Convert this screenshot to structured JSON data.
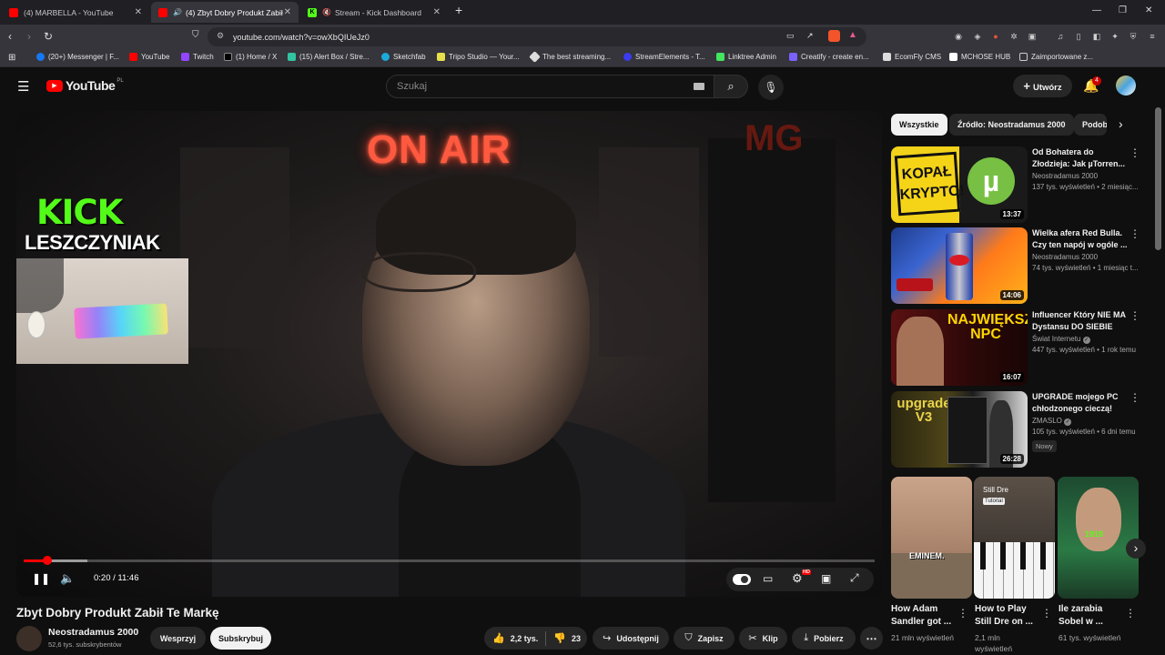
{
  "browser": {
    "tabs": [
      {
        "title": "(4) MARBELLA - YouTube"
      },
      {
        "title": "(4) Zbyt Dobry Produkt Zabił",
        "active": true
      },
      {
        "title": "Stream - Kick Dashboard"
      }
    ],
    "url": "youtube.com/watch?v=owXbQIUeJz0",
    "bookmarks": [
      "(20+) Messenger | F...",
      "YouTube",
      "Twitch",
      "(1) Home / X",
      "(15) Alert Box / Stre...",
      "Sketchfab",
      "Tripo Studio — Your...",
      "The best streaming...",
      "StreamElements - T...",
      "Linktree Admin",
      "Creatify - create en...",
      "EcomFly CMS",
      "MCHOSE HUB",
      "Zaimportowane z..."
    ]
  },
  "youtube": {
    "logo": "YouTube",
    "region": "PL",
    "search_placeholder": "Szukaj",
    "create_label": "Utwórz",
    "notifications": "4"
  },
  "video": {
    "title": "Zbyt Dobry Produkt Zabił Te Markę",
    "time": "0:20 / 11:46",
    "progress_fraction": 0.028,
    "buffered_fraction": 0.075,
    "overlay_sign": "ON AIR",
    "kick_logo": "KICK",
    "kick_name": "LESZCZYNIAK",
    "hd_badge": "HD"
  },
  "channel": {
    "name": "Neostradamus 2000",
    "subs": "52,6 tys. subskrybentów",
    "support_label": "Wesprzyj",
    "subscribe_label": "Subskrybuj"
  },
  "actions": {
    "likes": "2,2 tys.",
    "dislikes": "23",
    "share": "Udostępnij",
    "save": "Zapisz",
    "clip": "Klip",
    "download": "Pobierz"
  },
  "filters": [
    "Wszystkie",
    "Źródło: Neostradamus 2000",
    "Podob"
  ],
  "recommendations": [
    {
      "title": "Od Bohatera do Złodzieja: Jak µTorren...",
      "channel": "Neostradamus 2000",
      "meta": "137 tys. wyświetleń • 2 miesiąc...",
      "duration": "13:37",
      "thumb_text": "KOPAŁ KRYPTO!"
    },
    {
      "title": "Wielka afera Red Bulla. Czy ten napój w ogóle ...",
      "channel": "Neostradamus 2000",
      "meta": "74 tys. wyświetleń • 1 miesiąc t...",
      "duration": "14:06",
      "thumb_text": ""
    },
    {
      "title": "Influencer Który NIE MA Dystansu DO SIEBIE",
      "channel": "Świat Internetu",
      "meta": "447 tys. wyświetleń • 1 rok temu",
      "duration": "16:07",
      "thumb_text": "NAJWIĘKSZY NPC"
    },
    {
      "title": "UPGRADE mojego PC chłodzonego cieczą!",
      "channel": "ZMASLO",
      "meta": "105 tys. wyświetleń • 6 dni temu",
      "duration": "26:28",
      "badge": "Nowy",
      "thumb_text": "upgrade V3"
    }
  ],
  "shorts": [
    {
      "title": "How Adam Sandler got ...",
      "views": "21 mln wyświetleń",
      "thumb_text": "EMINEM."
    },
    {
      "title": "How to Play Still Dre on ...",
      "views": "2,1 mln wyświetleń",
      "thumb_text": "Still Dre",
      "thumb_sub": "Tutorial"
    },
    {
      "title": "Ile zarabia Sobel w ...",
      "views": "61 tys. wyświetleń",
      "thumb_text": "1919"
    }
  ]
}
